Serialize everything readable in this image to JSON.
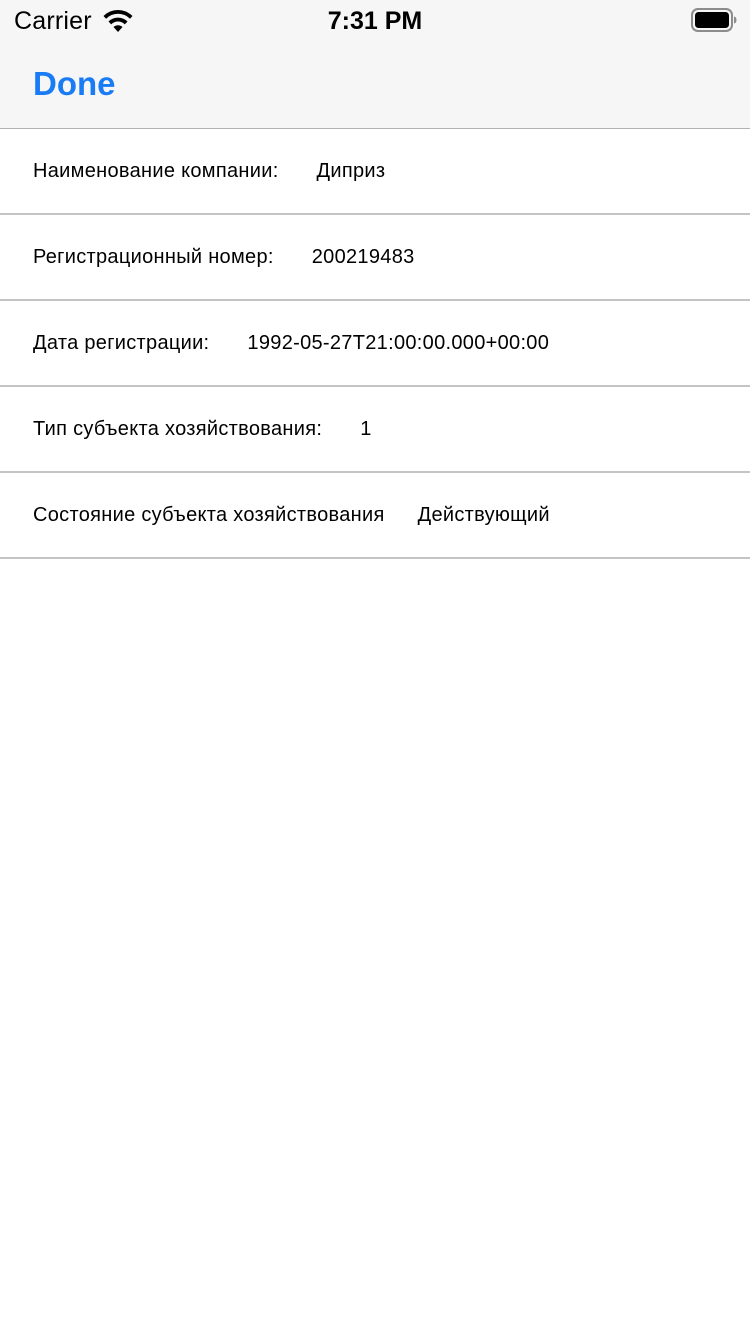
{
  "status_bar": {
    "carrier": "Carrier",
    "time": "7:31 PM",
    "wifi_icon": "wifi-icon",
    "battery_icon": "battery-icon"
  },
  "nav": {
    "done_label": "Done",
    "accent_color": "#1a7cf5"
  },
  "rows": [
    {
      "label": "Наименование компании:",
      "value": "Диприз"
    },
    {
      "label": "Регистрационный номер:",
      "value": "200219483"
    },
    {
      "label": "Дата регистрации:",
      "value": "1992-05-27T21:00:00.000+00:00"
    },
    {
      "label": "Тип субъекта хозяйствования:",
      "value": "1"
    },
    {
      "label": "Состояние субъекта хозяйствования",
      "value": "Действующий"
    }
  ]
}
